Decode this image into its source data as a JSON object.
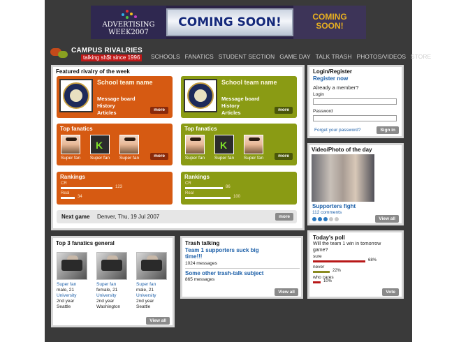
{
  "colors": {
    "accent_orange": "#d65a12",
    "accent_olive": "#8a9b14",
    "link_blue": "#1c5fa8",
    "bar_red": "#b81818",
    "bar_olive": "#8a8a20"
  },
  "banner": {
    "adweek_line1": "ADVERTISING",
    "adweek_line2": "WEEK2007",
    "coming_soon": "COMING SOON!",
    "coming_soon2_line1": "COMING",
    "coming_soon2_line2": "SOON!"
  },
  "header": {
    "logo_name": "CAMPUS RIVALRIES",
    "logo_tag": "talking sh$t since 1996"
  },
  "nav": {
    "items": [
      "SCHOOLS",
      "FANATICS",
      "STUDENT SECTION",
      "GAME DAY",
      "TALK TRASH",
      "PHOTOS/VIDEOS",
      "STORE"
    ]
  },
  "featured": {
    "title": "Featured rivalry of the week",
    "schools": [
      {
        "name": "School team name",
        "links": [
          "Message board",
          "History",
          "Articles"
        ],
        "more": "more"
      },
      {
        "name": "School team name",
        "links": [
          "Message board",
          "History",
          "Articles"
        ],
        "more": "more"
      }
    ],
    "top_fanatics": [
      {
        "title": "Top fanatics",
        "fans": [
          "Super fan",
          "Super fan",
          "Super fan"
        ],
        "more": "more"
      },
      {
        "title": "Top fanatics",
        "fans": [
          "Super fan",
          "Super fan",
          "Super fan"
        ],
        "more": "more"
      }
    ],
    "rankings": [
      {
        "title": "Rankings",
        "rows": [
          {
            "label": "CR",
            "value": "123",
            "fraction": 0.82
          },
          {
            "label": "Real",
            "value": "34",
            "fraction": 0.22
          }
        ]
      },
      {
        "title": "Rankings",
        "rows": [
          {
            "label": "CR",
            "value": "86",
            "fraction": 0.6
          },
          {
            "label": "Real",
            "value": "100",
            "fraction": 0.72
          }
        ]
      }
    ],
    "next_game": {
      "label": "Next game",
      "value": "Denver, Thu, 19 Jul 2007",
      "more": "more"
    }
  },
  "login": {
    "title": "Login/Register",
    "register": "Register now",
    "member": "Already a member?",
    "login_label": "Login",
    "login_value": "",
    "password_label": "Password",
    "password_value": "",
    "forgot": "Forget your password?",
    "signin": "Sign in"
  },
  "video": {
    "title": "Video/Photo of the day",
    "caption": "Supporters fight",
    "comments": "112 comments",
    "rating": 3,
    "rating_max": 5,
    "view_all": "View all"
  },
  "top3": {
    "title": "Top 3 fanatics general",
    "fans": [
      {
        "name": "Super fan",
        "info": "male, 21",
        "school": "University",
        "year": "2nd year",
        "city": "Seattle"
      },
      {
        "name": "Super fan",
        "info": "female, 21",
        "school": "University",
        "year": "2nd year",
        "city": "Washington"
      },
      {
        "name": "Super fan",
        "info": "male, 21",
        "school": "University",
        "year": "2nd year",
        "city": "Seattle"
      }
    ],
    "view_all": "View all"
  },
  "trash": {
    "title": "Trash talking",
    "items": [
      {
        "subject": "Team 1 supporters suck big time!!!",
        "messages": "1024 messages"
      },
      {
        "subject": "Some other trash-talk subject",
        "messages": "865 messages"
      }
    ],
    "view_all": "View all"
  },
  "poll": {
    "title": "Today's poll",
    "question": "Will the team 1 win in tomorrow game?",
    "options": [
      {
        "label": "sure",
        "pct": "68%",
        "value": 68
      },
      {
        "label": "never",
        "pct": "22%",
        "value": 22
      },
      {
        "label": "who cares",
        "pct": "10%",
        "value": 10
      }
    ],
    "vote": "Vote"
  }
}
